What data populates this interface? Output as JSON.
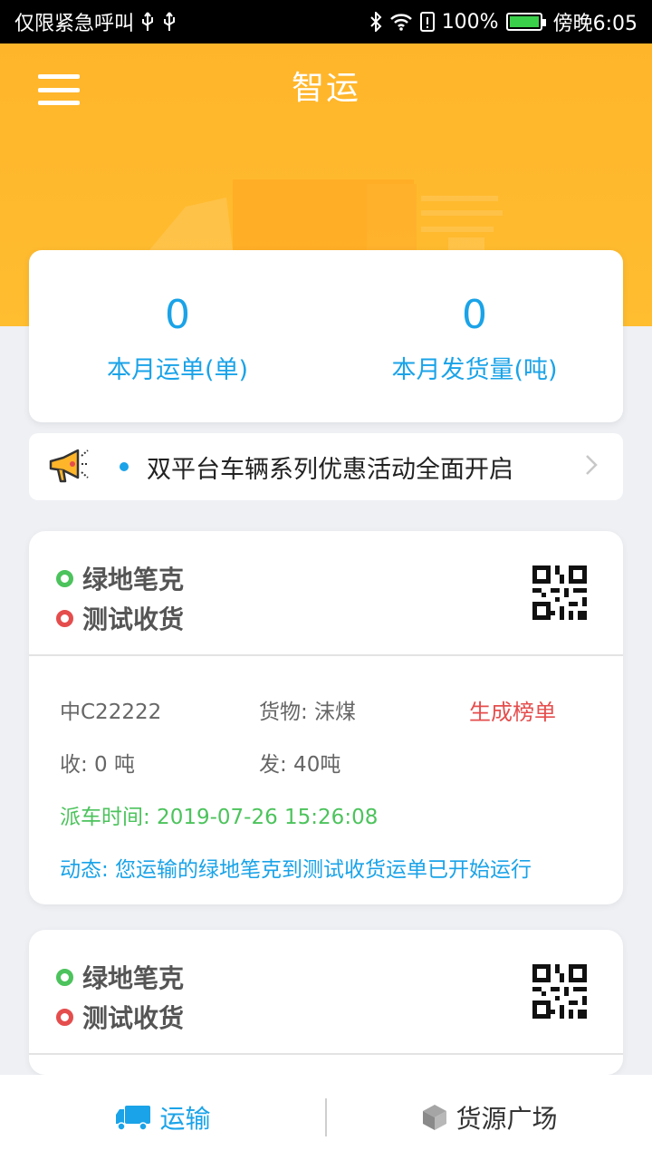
{
  "status_bar": {
    "left_text": "仅限紧急呼叫",
    "battery": "100%",
    "time": "傍晚6:05"
  },
  "header": {
    "title": "智运"
  },
  "stats": [
    {
      "value": "0",
      "label": "本月运单(单)"
    },
    {
      "value": "0",
      "label": "本月发货量(吨)"
    }
  ],
  "notice": {
    "text": "双平台车辆系列优惠活动全面开启"
  },
  "orders": [
    {
      "origin": "绿地笔克",
      "destination": "测试收货",
      "plate": "中C22222",
      "cargo": "货物: 沫煤",
      "action": "生成榜单",
      "received": "收: 0 吨",
      "sent": "发: 40吨",
      "dispatch_time": "派车时间: 2019-07-26 15:26:08",
      "dynamic": "动态: 您运输的绿地笔克到测试收货运单已开始运行"
    },
    {
      "origin": "绿地笔克",
      "destination": "测试收货"
    }
  ],
  "tabs": [
    {
      "label": "运输",
      "icon": "truck-icon",
      "active": true
    },
    {
      "label": "货源广场",
      "icon": "box-icon",
      "active": false
    }
  ],
  "colors": {
    "accent": "#1aa3e8",
    "header": "#ffb52a",
    "green": "#4cc35c",
    "red": "#e54d4d"
  }
}
